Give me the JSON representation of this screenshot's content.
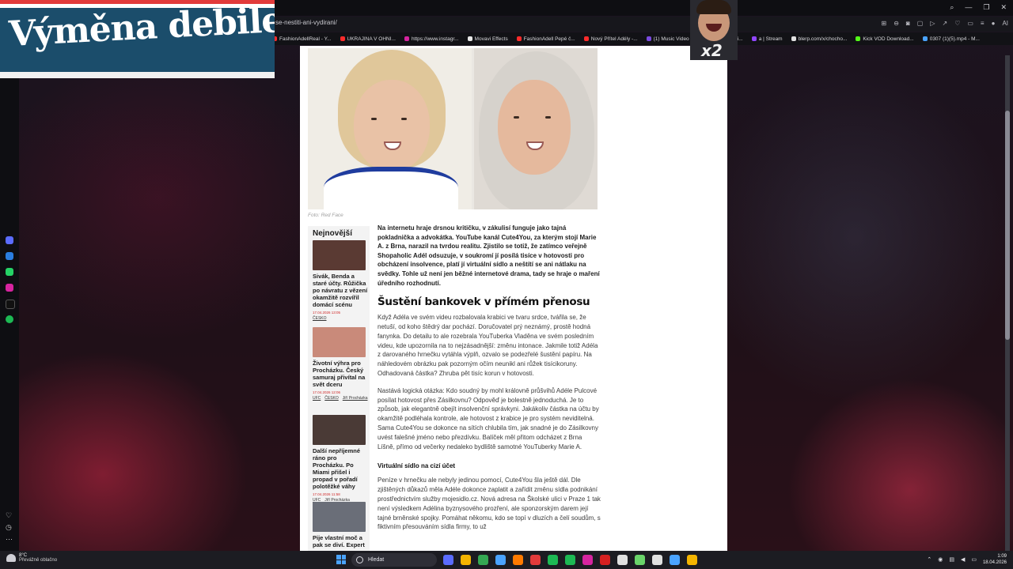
{
  "overlay": {
    "title": "Výměna debilek",
    "webcam_badge": "x2"
  },
  "browser": {
    "url": "se-nestiti-ani-vydirani/",
    "bookmarks": [
      {
        "label": "FashionAdellReal - Y...",
        "color": "#ff2b2b"
      },
      {
        "label": "UKRAJINA V OHNI...",
        "color": "#ff2b2b"
      },
      {
        "label": "https://www.instagr...",
        "color": "#d6249f"
      },
      {
        "label": "Movavi Effects",
        "color": "#e8e8e8"
      },
      {
        "label": "FashionAdell Pepé č...",
        "color": "#ff2b2b"
      },
      {
        "label": "Nový Přítel Adély -...",
        "color": "#ff2b2b"
      },
      {
        "label": "(1) Music Video Fre...",
        "color": "#7a4ae0"
      },
      {
        "label": "Blog :: Fi...",
        "color": "#2a7ee0"
      },
      {
        "label": "a | Stream",
        "color": "#9146ff"
      },
      {
        "label": "blerp.com/x/chocho...",
        "color": "#e0e0e0"
      },
      {
        "label": "Kick VOD Download...",
        "color": "#53fc18"
      },
      {
        "label": "0307 (1)(5).mp4 - M...",
        "color": "#4aa3ff"
      }
    ],
    "ai_label": "AI"
  },
  "article": {
    "photo_caption": "Foto: Red Face",
    "sidebar": {
      "heading": "Nejnovější",
      "items": [
        {
          "title": "Sivák, Benda a staré účty. Růžička po návratu z vězení okamžitě rozvířil domácí scénu",
          "date": "17.04.2026 13:05",
          "tags": [
            "ČESKO"
          ],
          "thumb_color": "#5a3a33"
        },
        {
          "title": "Životní výhra pro Procházku. Český samuraj přivítal na svět dceru",
          "date": "17.04.2026 12:06",
          "tags": [
            "UFC",
            "ČESKO",
            "Jiří Procházka"
          ],
          "thumb_color": "#c98a7a"
        },
        {
          "title": "Další nepříjemné ráno pro Procházku. Po Miami přišel i propad v pořadí polotěžké váhy",
          "date": "17.04.2026 11:58",
          "tags": [
            "UFC",
            "Jiří Procházka"
          ],
          "thumb_color": "#4a3a36"
        },
        {
          "title": "Pije vlastní moč a pak se diví. Expert",
          "date": "",
          "tags": [],
          "thumb_color": "#6a6e78"
        }
      ]
    },
    "lead": "Na internetu hraje drsnou kritičku, v zákulisí funguje jako tajná pokladnička a advokátka. YouTube kanál Cute4You, za kterým stojí Marie A. z Brna, narazil na tvrdou realitu. Zjistilo se totiž, že zatímco veřejně Shopaholic Adél odsuzuje, v soukromí jí posílá tisíce v hotovosti pro obcházení insolvence, platí jí virtuální sídlo a neštítí se ani nátlaku na svědky. Tohle už není jen běžné internetové drama, tady se hraje o maření úředního rozhodnutí.",
    "heading1": "Šustění bankovek v přímém přenosu",
    "para1": "Když Adéla ve svém videu rozbalovala krabici ve tvaru srdce, tvářila se, že netuší, od koho štědrý dar pochází. Doručovatel prý neznámý, prostě hodná fanynka. Do detailu to ale rozebrala YouTuberka Vladěna ve svém posledním videu, kde upozornila na to nejzásadnější: změnu intonace. Jakmile totiž Adéla z darovaného hrnečku vytáhla výplň, ozvalo se podezřelé šustění papíru. Na náhledovém obrázku pak pozorným očím neunikl ani růžek tisícikoruny. Odhadovaná částka? Zhruba pět tisíc korun v hotovosti.",
    "para2": "Nastává logická otázka: Kdo soudný by mohl královně průšvihů Adéle Pulcové posílat hotovost přes Zásilkovnu? Odpověď je bolestně jednoduchá. Je to způsob, jak elegantně obejít insolvenční správkyni. Jakákoliv částka na účtu by okamžitě podléhala kontrole, ale hotovost z krabice je pro systém neviditelná. Sama Cute4You se dokonce na sítích chlubila tím, jak snadné je do Zásilkovny uvést falešné jméno nebo přezdívku. Balíček měl přitom odcházet z Brna Líšně, přímo od večerky nedaleko bydliště samotné YouTuberky Marie A.",
    "heading2": "Virtuální sídlo na cizí účet",
    "para3": "Peníze v hrnečku ale nebyly jedinou pomocí, Cute4You šla ještě dál. Dle zjištěných důkazů měla Adéle dokonce zaplatit a zařídit změnu sídla podnikání prostřednictvím služby mojesidlo.cz. Nová adresa na Školské ulici v Praze 1 tak není výsledkem Adélina byznysového prozření, ale sponzorským darem její tajné brněnské spojky. Pomáhat někomu, kdo se topí v dluzích a čelí soudům, s fiktivním přesouváním sídla firmy, to už"
  },
  "taskbar": {
    "weather_temp": "8°C",
    "weather_desc": "Převážně oblačno",
    "search_label": "Hledat",
    "apps": [
      "#5b6cff",
      "#f4b400",
      "#34a853",
      "#4aa3ff",
      "#ff7a00",
      "#e23b3b",
      "#1db954",
      "#1db954",
      "#d6249f",
      "#d62020",
      "#e0e0e0",
      "#6ad46a",
      "#e0e0e0",
      "#4aa3ff",
      "#f4b400"
    ],
    "time": "1:09",
    "date": "18.04.2026"
  }
}
